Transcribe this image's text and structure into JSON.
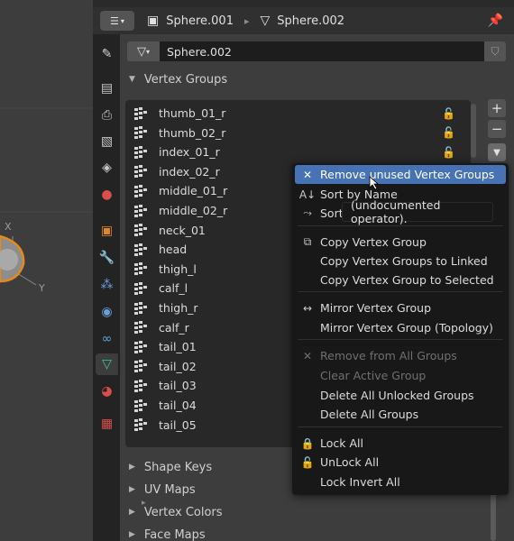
{
  "viewport": {
    "axis_x": "X",
    "axis_y": "Y"
  },
  "header": {
    "object_name": "Sphere.001",
    "mesh_name": "Sphere.002"
  },
  "datablock": {
    "mesh_name": "Sphere.002"
  },
  "vertex_groups": {
    "title": "Vertex Groups",
    "items": [
      "thumb_01_r",
      "thumb_02_r",
      "index_01_r",
      "index_02_r",
      "middle_01_r",
      "middle_02_r",
      "neck_01",
      "head",
      "thigh_l",
      "calf_l",
      "thigh_r",
      "calf_r",
      "tail_01",
      "tail_02",
      "tail_03",
      "tail_04",
      "tail_05"
    ]
  },
  "sections": [
    "Shape Keys",
    "UV Maps",
    "Vertex Colors",
    "Face Maps"
  ],
  "menu": {
    "items": [
      {
        "label": "Remove unused Vertex Groups",
        "icon": "x-icon",
        "state": "highlighted"
      },
      {
        "label": "Sort by Name",
        "icon": "sort-alpha-icon",
        "state": "normal"
      },
      {
        "label": "Sort",
        "icon": "sort-bone-icon",
        "state": "normal"
      },
      {
        "label": "Copy Vertex Group",
        "icon": "copy-icon",
        "state": "normal"
      },
      {
        "label": "Copy Vertex Groups to Linked",
        "icon": "",
        "state": "normal"
      },
      {
        "label": "Copy Vertex Group to Selected",
        "icon": "",
        "state": "normal"
      },
      {
        "label": "Mirror Vertex Group",
        "icon": "mirror-arrows-icon",
        "state": "normal"
      },
      {
        "label": "Mirror Vertex Group (Topology)",
        "icon": "",
        "state": "normal"
      },
      {
        "label": "Remove from All Groups",
        "icon": "x-icon",
        "state": "disabled"
      },
      {
        "label": "Clear Active Group",
        "icon": "",
        "state": "disabled"
      },
      {
        "label": "Delete All Unlocked Groups",
        "icon": "",
        "state": "normal"
      },
      {
        "label": "Delete All Groups",
        "icon": "",
        "state": "normal"
      },
      {
        "label": "Lock All",
        "icon": "lock-closed-icon",
        "state": "normal"
      },
      {
        "label": "UnLock All",
        "icon": "lock-open-icon",
        "state": "normal"
      },
      {
        "label": "Lock Invert All",
        "icon": "",
        "state": "normal"
      }
    ]
  },
  "tooltip": "(undocumented operator)."
}
